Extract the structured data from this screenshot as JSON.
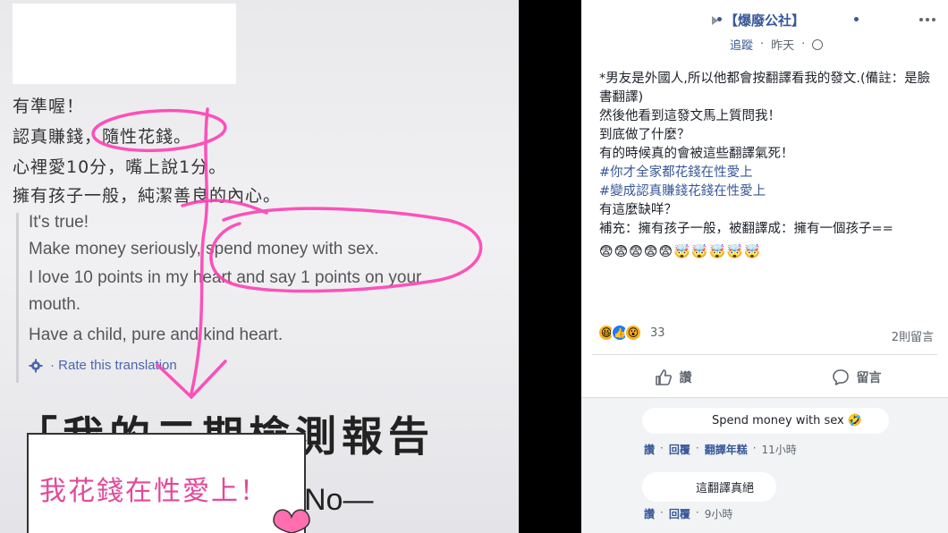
{
  "photo": {
    "zh_lines": [
      "有準喔！",
      "認真賺錢，隨性花錢。",
      "心裡愛10分，嘴上說1分。",
      "擁有孩子一般，純潔善良的內心。"
    ],
    "en_lines": [
      "It's true!",
      "Make money seriously, spend money with sex.",
      "I love 10 points in my heart and say 1 points on your",
      "mouth.",
      "Have a child, pure and kind heart."
    ],
    "rate_translation": "· Rate this translation",
    "report_title": "「我的二期檢測報告",
    "report_no": "No—",
    "note_text": "我花錢在性愛上！",
    "accent_color": "#ff3fb4"
  },
  "post": {
    "page_name": "【爆廢公社】",
    "follow": "追蹤",
    "time": "昨天",
    "body_lines": [
      {
        "text": "*男友是外國人,所以他都會按翻譯看我的發文.(備註：是臉書翻譯)",
        "type": "text"
      },
      {
        "text": "然後他看到這發文馬上質問我！",
        "type": "text"
      },
      {
        "text": "到底做了什麼？",
        "type": "text"
      },
      {
        "text": "有的時候真的會被這些翻譯氣死！",
        "type": "text"
      },
      {
        "text": "#你才全家都花錢在性愛上",
        "type": "tag"
      },
      {
        "text": "#變成認真賺錢花錢在性愛上",
        "type": "tag"
      },
      {
        "text": "有這麼缺咩？",
        "type": "text"
      },
      {
        "text": "補充：擁有孩子一般，被翻譯成：擁有一個孩子==",
        "type": "text"
      }
    ],
    "emojis": "😨😨😨😨😨🤯🤯🤯🤯🤯",
    "reaction_count": "33",
    "comments_count": "2則留言",
    "like_label": "讚",
    "comment_label": "留言",
    "comments": [
      {
        "text": "Spend money with sex 🤣",
        "like": "讚",
        "reply": "回覆",
        "translate": "翻譯年糕",
        "time": "11小時"
      },
      {
        "text": "這翻譯真絕",
        "like": "讚",
        "reply": "回覆",
        "time": "9小時"
      }
    ]
  }
}
